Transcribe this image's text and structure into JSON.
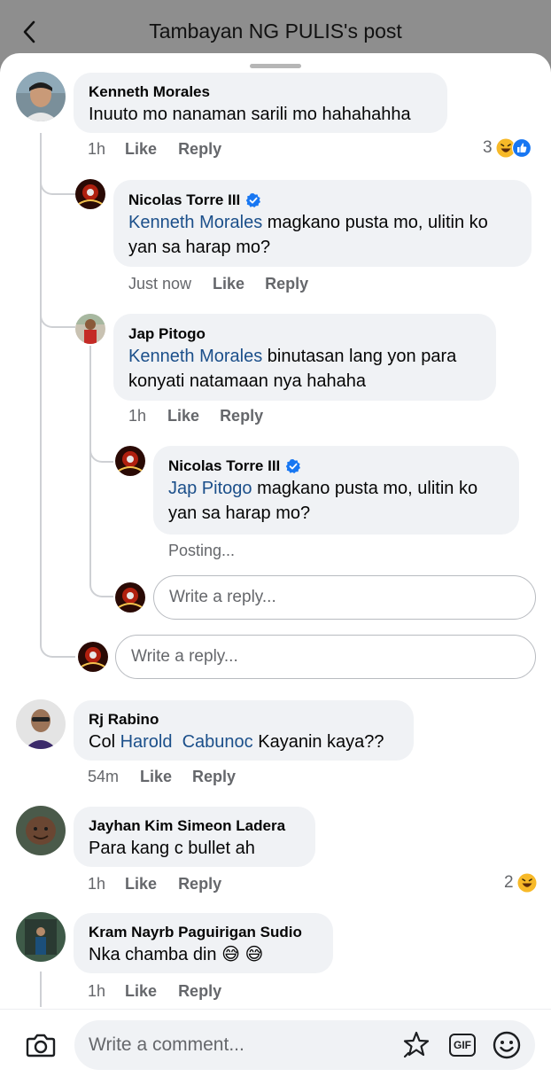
{
  "header": {
    "title": "Tambayan NG PULIS's post"
  },
  "comments": {
    "c1": {
      "author": "Kenneth Morales",
      "text": "Inuuto mo nanaman sarili mo hahahahha",
      "time": "1h",
      "like": "Like",
      "reply": "Reply",
      "reaction_count": "3"
    },
    "r1": {
      "author": "Nicolas Torre III",
      "mention": "Kenneth Morales",
      "text": " magkano pusta mo, ulitin ko yan sa harap mo?",
      "time": "Just now",
      "like": "Like",
      "reply": "Reply"
    },
    "r2": {
      "author": "Jap Pitogo",
      "mention": "Kenneth Morales",
      "text": " binutasan lang yon para konyati natamaan nya hahaha",
      "time": "1h",
      "like": "Like",
      "reply": "Reply"
    },
    "r3": {
      "author": "Nicolas Torre III",
      "mention": "Jap Pitogo",
      "text": " magkano pusta mo, ulitin ko yan sa harap mo?",
      "status": "Posting..."
    },
    "c2": {
      "author": "Rj Rabino",
      "prefix": "Col ",
      "mention": "Harold  Cabunoc",
      "text": " Kayanin kaya??",
      "time": "54m",
      "like": "Like",
      "reply": "Reply"
    },
    "c3": {
      "author": "Jayhan Kim Simeon Ladera",
      "text": "Para kang c bullet ah",
      "time": "1h",
      "like": "Like",
      "reply": "Reply",
      "reaction_count": "2"
    },
    "c4": {
      "author": "Kram Nayrb Paguirigan Sudio",
      "text": "Nka chamba din 😅 😅",
      "time": "1h",
      "like": "Like",
      "reply": "Reply"
    }
  },
  "reply_inputs": {
    "nested_placeholder": "Write a reply...",
    "thread_placeholder": "Write a reply..."
  },
  "composer": {
    "placeholder": "Write a comment...",
    "gif_label": "GIF"
  },
  "colors": {
    "mention": "#1b4f8a",
    "like_blue": "#1877f2",
    "haha_yellow": "#f7b928"
  },
  "icons": [
    "back-icon",
    "verified-icon",
    "haha-reaction-icon",
    "like-reaction-icon",
    "camera-icon",
    "avatar-sticker-icon",
    "gif-icon",
    "emoji-icon"
  ]
}
